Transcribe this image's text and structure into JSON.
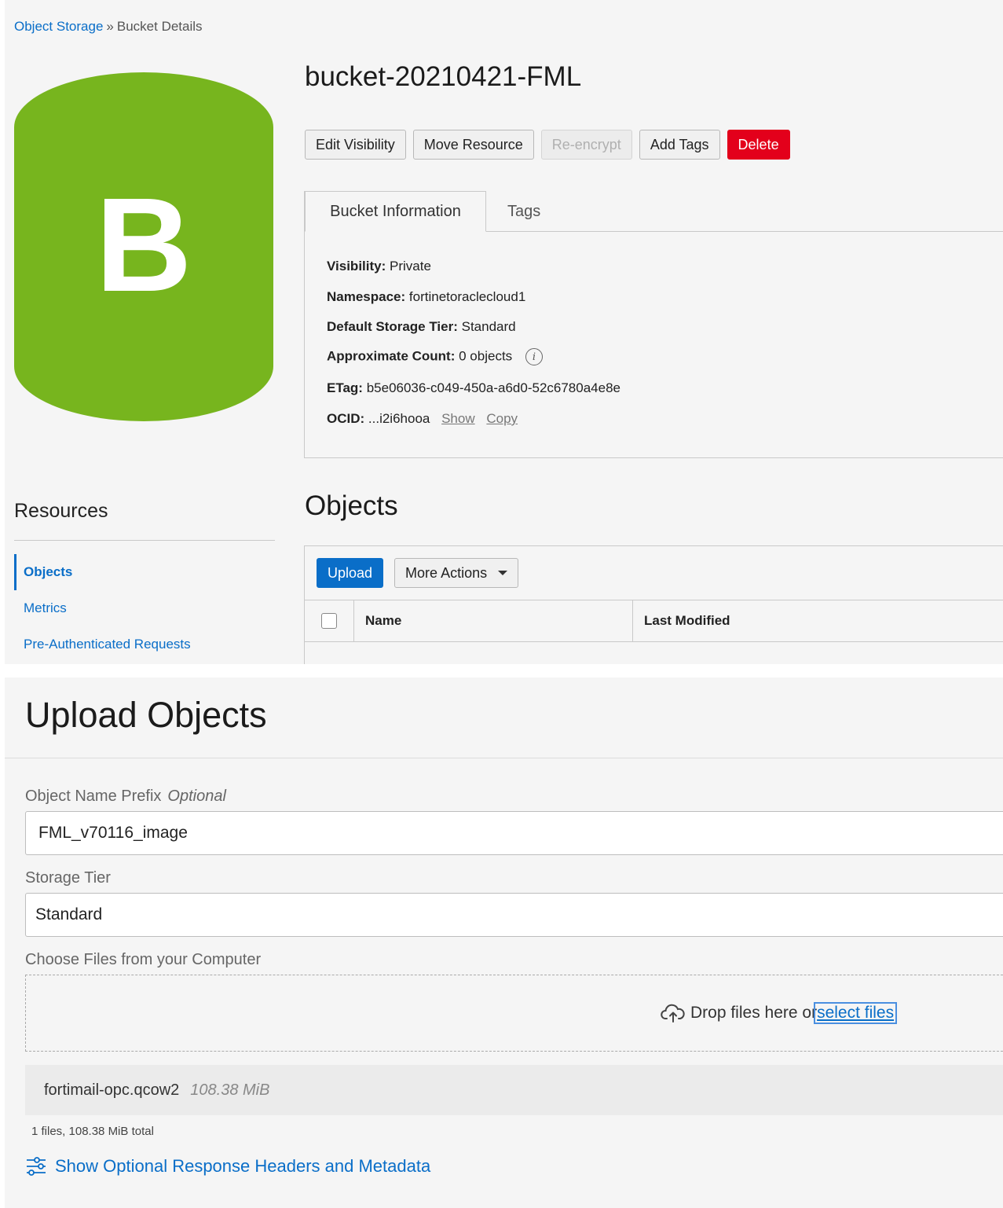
{
  "breadcrumb": {
    "root": "Object Storage",
    "separator": "»",
    "current": "Bucket Details"
  },
  "bucket_icon": {
    "letter": "B",
    "color": "#77b51e",
    "icon": "bucket-icon"
  },
  "bucket": {
    "name": "bucket-20210421-FML"
  },
  "actions": {
    "edit_visibility": "Edit Visibility",
    "move_resource": "Move Resource",
    "reencrypt": "Re-encrypt",
    "add_tags": "Add Tags",
    "delete": "Delete"
  },
  "tabs": {
    "bucket_info": "Bucket Information",
    "tags": "Tags"
  },
  "info": {
    "visibility_label": "Visibility:",
    "visibility_value": "Private",
    "namespace_label": "Namespace:",
    "namespace_value": "fortinetoraclecloud1",
    "tier_label": "Default Storage Tier:",
    "tier_value": "Standard",
    "count_label": "Approximate Count:",
    "count_value": "0 objects",
    "info_icon": "i",
    "etag_label": "ETag:",
    "etag_value": "b5e06036-c049-450a-a6d0-52c6780a4e8e",
    "ocid_label": "OCID:",
    "ocid_value": "...i2i6hooa",
    "ocid_show": "Show",
    "ocid_copy": "Copy"
  },
  "resources": {
    "title": "Resources",
    "items": [
      "Objects",
      "Metrics",
      "Pre-Authenticated Requests"
    ]
  },
  "objects": {
    "title": "Objects",
    "upload": "Upload",
    "more_actions": "More Actions",
    "columns": [
      "Name",
      "Last Modified"
    ]
  },
  "upload_dialog": {
    "title": "Upload Objects",
    "prefix_label": "Object Name Prefix",
    "prefix_optional": "Optional",
    "prefix_value": "FML_v70116_image",
    "tier_label": "Storage Tier",
    "tier_value": "Standard",
    "choose_label": "Choose Files from your Computer",
    "drop_text": "Drop files here or",
    "select_files": "select files",
    "file_name": "fortimail-opc.qcow2",
    "file_size": "108.38 MiB",
    "summary": "1 files, 108.38 MiB total",
    "optional_link": "Show Optional Response Headers and Metadata"
  },
  "colors": {
    "accent": "#0a6ec8",
    "danger": "#e3001b",
    "bucket_green": "#77b51e"
  }
}
